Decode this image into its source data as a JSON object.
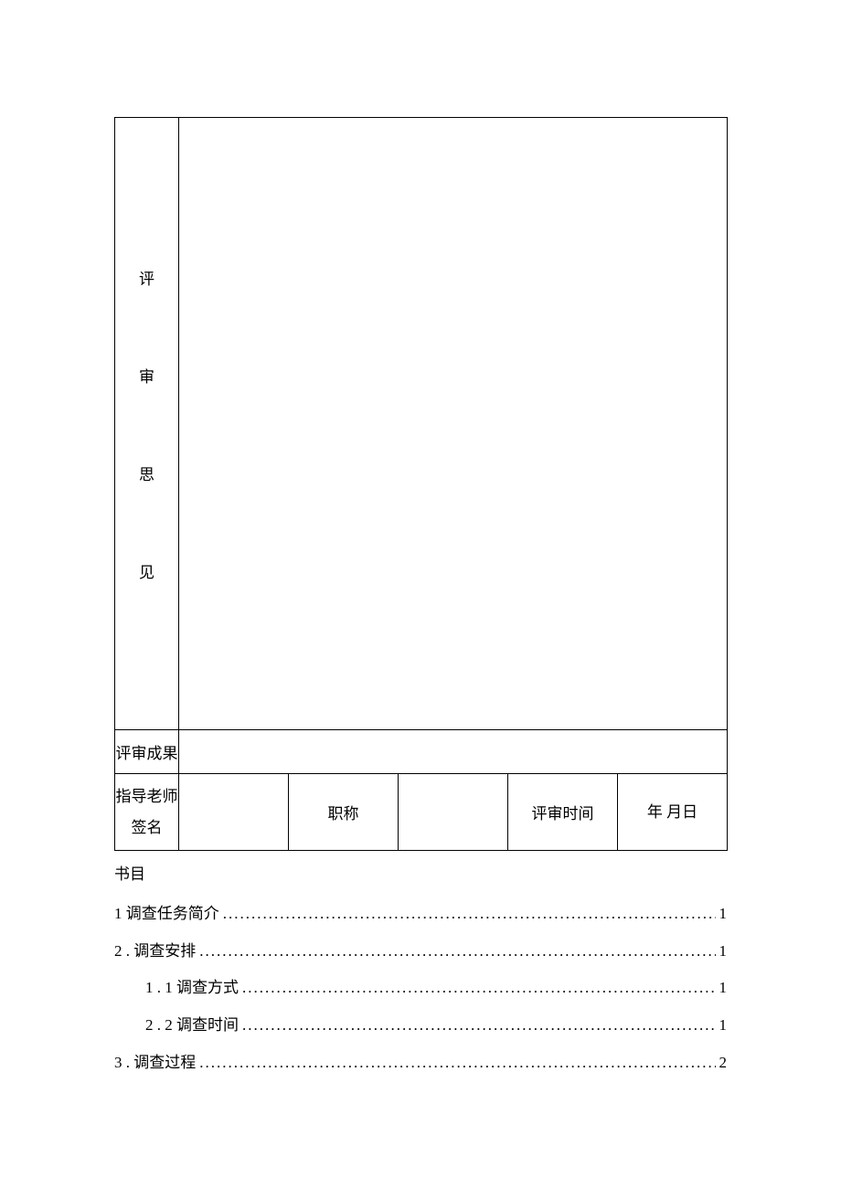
{
  "form": {
    "row1_label_chars": [
      "评",
      "审",
      "思",
      "见"
    ],
    "row2": {
      "label": "评审成果",
      "value": ""
    },
    "row3": {
      "c1": "指导老师签名",
      "c2": "",
      "c3": "职称",
      "c4": "",
      "c5": "评审时间",
      "c6": "年 月日"
    }
  },
  "toc": {
    "title": "书目",
    "items": [
      {
        "label": "1 调查任务简介",
        "page": "1",
        "indent": false
      },
      {
        "label": "2 . 调查安排",
        "page": "1",
        "indent": false
      },
      {
        "label": "1 . 1 调查方式",
        "page": "1",
        "indent": true
      },
      {
        "label": "2 . 2 调查时间",
        "page": "1",
        "indent": true
      },
      {
        "label": "3 . 调查过程",
        "page": "2",
        "indent": false
      }
    ]
  }
}
